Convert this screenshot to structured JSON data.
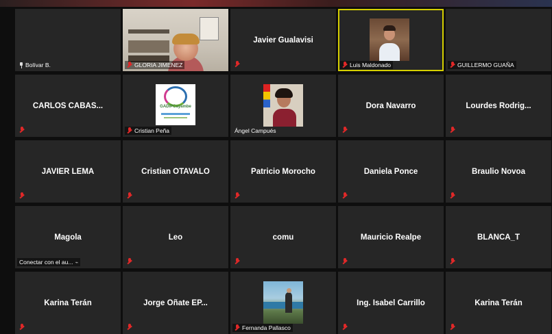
{
  "meeting": {
    "tiles": [
      {
        "name": "",
        "label": "Bolívar B.",
        "label_pinned": true
      },
      {
        "name": "",
        "label": "GLORIA JIMENEZ",
        "video": "gloria"
      },
      {
        "name": "Javier Gualavisi",
        "label": ""
      },
      {
        "name": "",
        "label": "Luis Maldonado",
        "video": "luis",
        "active": true
      },
      {
        "name": "",
        "label": "GUILLERMO GUAÑA"
      },
      {
        "name": "CARLOS CABAS...",
        "label": ""
      },
      {
        "name": "",
        "label": "Cristian Peña",
        "video": "logo"
      },
      {
        "name": "",
        "label": "Ángel Campués",
        "video": "angel"
      },
      {
        "name": "Dora Navarro",
        "label": ""
      },
      {
        "name": "Lourdes Rodrig...",
        "label": ""
      },
      {
        "name": "JAVIER LEMA",
        "label": ""
      },
      {
        "name": "Cristian OTAVALO",
        "label": ""
      },
      {
        "name": "Patricio Morocho",
        "label": ""
      },
      {
        "name": "Daniela Ponce",
        "label": ""
      },
      {
        "name": "Braulio Novoa",
        "label": ""
      },
      {
        "name": "Magola",
        "label": "Conectar con el au...",
        "label_nomic": true
      },
      {
        "name": "Leo",
        "label": ""
      },
      {
        "name": "comu",
        "label": ""
      },
      {
        "name": "Mauricio Realpe",
        "label": ""
      },
      {
        "name": "BLANCA_T",
        "label": ""
      },
      {
        "name": "Karina Terán",
        "label": ""
      },
      {
        "name": "Jorge Oñate EP...",
        "label": ""
      },
      {
        "name": "",
        "label": "Fernanda Pallasco",
        "video": "fernanda"
      },
      {
        "name": "Ing. Isabel Carrillo",
        "label": ""
      },
      {
        "name": "Karina Terán",
        "label": ""
      }
    ],
    "logo_text": "GADIPCayambe",
    "active_color": "#d6d000",
    "muted_color": "#e02828"
  }
}
